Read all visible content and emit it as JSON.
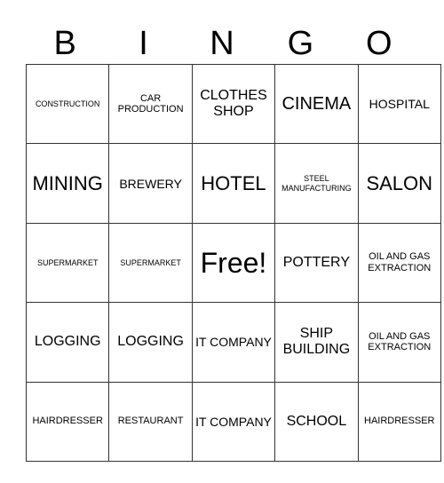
{
  "header": {
    "letters": [
      "B",
      "I",
      "N",
      "G",
      "O"
    ]
  },
  "rows": [
    [
      "CONSTRUCTION",
      "CAR PRODUCTION",
      "CLOTHES SHOP",
      "CINEMA",
      "HOSPITAL"
    ],
    [
      "MINING",
      "BREWERY",
      "HOTEL",
      "STEEL MANUFACTURING",
      "SALON"
    ],
    [
      "SUPERMARKET",
      "SUPERMARKET",
      "Free!",
      "POTTERY",
      "OIL AND GAS EXTRACTION"
    ],
    [
      "LOGGING",
      "LOGGING",
      "IT COMPANY",
      "SHIP BUILDING",
      "OIL AND GAS EXTRACTION"
    ],
    [
      "HAIRDRESSER",
      "RESTAURANT",
      "IT COMPANY",
      "SCHOOL",
      "HAIRDRESSER"
    ]
  ]
}
